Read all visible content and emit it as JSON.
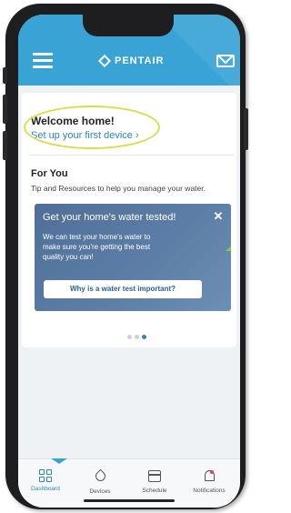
{
  "header": {
    "brand": "PENTAIR",
    "accent_color": "#39a3d6",
    "menu_icon": "hamburger-menu-icon",
    "mail_icon": "mail-icon"
  },
  "welcome": {
    "title": "Welcome home!",
    "setup_link": "Set up your first device ›"
  },
  "for_you": {
    "title": "For You",
    "subtitle": "Tip and Resources to help you manage your water."
  },
  "promo": {
    "title": "Get your home's water tested!",
    "body": "We can test your home's water to make sure you're getting the best quality you can!",
    "button": "Why is a water test important?",
    "close": "✕"
  },
  "carousel": {
    "pages": 3,
    "active_page": 3
  },
  "tabs": [
    {
      "label": "Dashboard",
      "icon": "dashboard-grid-icon",
      "active": true
    },
    {
      "label": "Devices",
      "icon": "water-drop-icon",
      "active": false
    },
    {
      "label": "Schedule",
      "icon": "calendar-icon",
      "active": false
    },
    {
      "label": "Notifications",
      "icon": "bell-icon",
      "active": false
    }
  ]
}
